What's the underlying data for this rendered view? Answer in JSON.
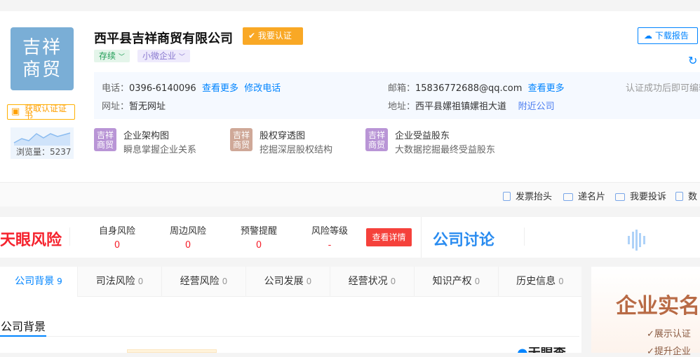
{
  "company": {
    "logo_text": "吉祥商贸",
    "name": "西平县吉祥商贸有限公司",
    "certify_badge": "我要认证",
    "status_tag": "存续",
    "scale_tag": "小微企业",
    "get_cert": "获取认证证书",
    "views_label": "浏览量：",
    "views": "5237",
    "download": "下载报告"
  },
  "info": {
    "phone_label": "电话：",
    "phone": "0396-6140096",
    "phone_more": "查看更多",
    "phone_edit": "修改电话",
    "site_label": "网址：",
    "site": "暂无网址",
    "email_label": "邮箱：",
    "email": "15836772688@qq.com",
    "email_more": "查看更多",
    "addr_label": "地址：",
    "addr": "西平县嫘祖镇嫘祖大道",
    "nearby": "附近公司",
    "edit_hint": "认证成功后即可编辑"
  },
  "features": [
    {
      "icon": "吉祥商贸",
      "title": "企业架构图",
      "desc": "瞬息掌握企业关系",
      "color": "#b995d6"
    },
    {
      "icon": "吉祥商贸",
      "title": "股权穿透图",
      "desc": "挖掘深层股权结构",
      "color": "#cfa898"
    },
    {
      "icon": "吉祥商贸",
      "title": "企业受益股东",
      "desc": "大数据挖掘最终受益股东",
      "color": "#b995d6"
    }
  ],
  "toolbar": [
    "发票抬头",
    "递名片",
    "我要投诉",
    "数"
  ],
  "risk": {
    "brand": "天眼风险",
    "items": [
      {
        "label": "自身风险",
        "value": "0"
      },
      {
        "label": "周边风险",
        "value": "0"
      },
      {
        "label": "预警提醒",
        "value": "0"
      },
      {
        "label": "风险等级",
        "value": "-"
      }
    ],
    "detail_btn": "查看详情",
    "discussion": "公司讨论"
  },
  "tabs": [
    {
      "label": "公司背景",
      "count": "9"
    },
    {
      "label": "司法风险",
      "count": "0"
    },
    {
      "label": "经营风险",
      "count": "0"
    },
    {
      "label": "公司发展",
      "count": "0"
    },
    {
      "label": "经营状况",
      "count": "0"
    },
    {
      "label": "知识产权",
      "count": "0"
    },
    {
      "label": "历史信息",
      "count": "0"
    }
  ],
  "section_title": "公司背景",
  "bottom_brand": "天眼查",
  "promo": {
    "title": "企业实名",
    "points": [
      "✓展示认证",
      "✓提升企业"
    ]
  }
}
